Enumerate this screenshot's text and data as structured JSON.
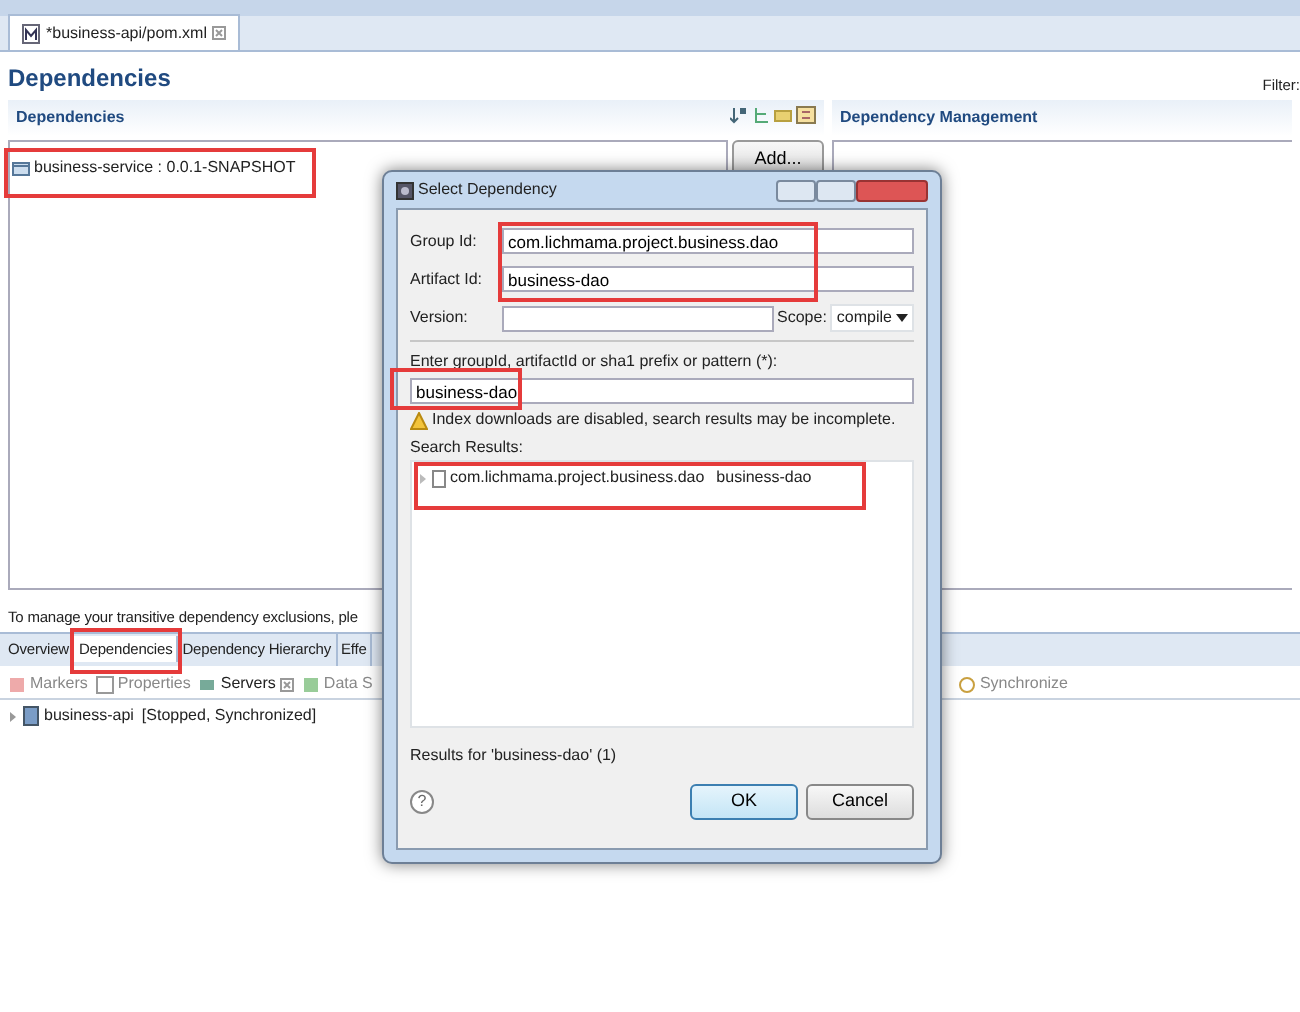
{
  "editor_tab": {
    "title": "*business-api/pom.xml"
  },
  "page_title": "Dependencies",
  "filter_label": "Filter:",
  "dependencies_section": {
    "title": "Dependencies",
    "items": [
      {
        "label": "business-service : 0.0.1-SNAPSHOT",
        "highlighted": true
      }
    ],
    "buttons": [
      "Add..."
    ]
  },
  "management_section": {
    "title": "Dependency Management"
  },
  "exclusions_hint": "To manage your transitive dependency exclusions, ple",
  "editor_tabs": [
    {
      "label": "Overview",
      "selected": false,
      "highlighted": false
    },
    {
      "label": "Dependencies",
      "selected": true,
      "highlighted": true
    },
    {
      "label": "Dependency Hierarchy",
      "selected": false,
      "highlighted": false
    },
    {
      "label": "Effe",
      "selected": false,
      "highlighted": false
    }
  ],
  "views": [
    {
      "label": "Markers",
      "selected": false
    },
    {
      "label": "Properties",
      "selected": false
    },
    {
      "label": "Servers",
      "selected": true
    },
    {
      "label": "Data S",
      "selected": false
    }
  ],
  "view_toolbar": [
    "Synchronize"
  ],
  "servers": [
    {
      "name": "business-api",
      "status": "[Stopped, Synchronized]"
    }
  ],
  "dialog": {
    "title": "Select Dependency",
    "coordinates_highlighted": true,
    "fields": [
      {
        "label": "Group Id:",
        "value": "com.lichmama.project.business.dao"
      },
      {
        "label": "Artifact Id:",
        "value": "business-dao"
      },
      {
        "label": "Version:"
      }
    ],
    "scope": {
      "label": "Scope:",
      "value": "compile"
    },
    "search": {
      "label": "Enter groupId, artifactId or sha1 prefix or pattern (*):",
      "value": "business-dao",
      "highlighted": true
    },
    "warning": "Index downloads are disabled, search results may be incomplete.",
    "results_label": "Search Results:",
    "results": [
      {
        "group": "com.lichmama.project.business.dao",
        "artifact": "business-dao",
        "highlighted": true
      }
    ],
    "results_summary": "Results for 'business-dao' (1)",
    "help_label": "?",
    "buttons": [
      {
        "label": "OK",
        "default": true
      },
      {
        "label": "Cancel",
        "default": false
      }
    ]
  }
}
